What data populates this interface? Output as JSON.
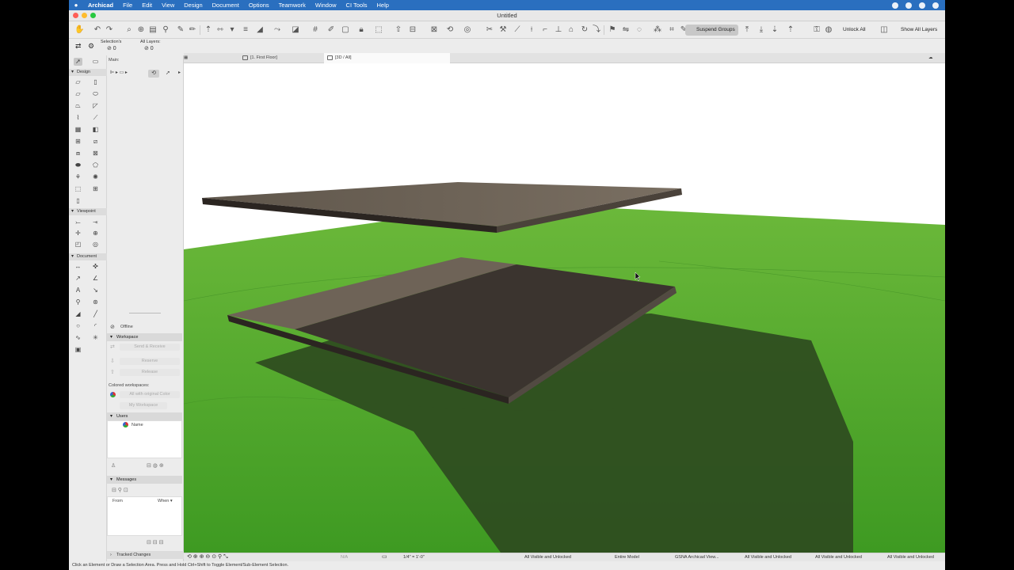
{
  "menubar": {
    "app": "Archicad",
    "items": [
      "File",
      "Edit",
      "View",
      "Design",
      "Document",
      "Options",
      "Teamwork",
      "Window",
      "CI Tools",
      "Help"
    ]
  },
  "window": {
    "title": "Untitled"
  },
  "toolbar": {
    "suspend_groups": "Suspend Groups",
    "unlock_all": "Unlock All",
    "show_all_layers": "Show All Layers"
  },
  "infobox": {
    "selections": "Selection's",
    "all_layers": "All Layers:",
    "main": "Main:"
  },
  "tabs": [
    {
      "label": "[1. First Floor]"
    },
    {
      "label": "[3D / All]"
    }
  ],
  "toolbox": {
    "sections": [
      "Design",
      "Viewpoint",
      "Document"
    ]
  },
  "teamwork": {
    "status": "Offline",
    "workspace_header": "Workspace",
    "send_receive": "Send & Receive",
    "reserve": "Reserve",
    "release": "Release",
    "colored_workspaces": "Colored workspaces:",
    "color_option": "All with original Color",
    "my_workspace": "My Workspace",
    "users_header": "Users",
    "name_col": "Name",
    "messages_header": "Messages",
    "from_col": "From",
    "when_col": "When",
    "tracked_changes": "Tracked Changes"
  },
  "statusbar": {
    "na": "N/A",
    "scale": "1/4\"   =   1'-0\"",
    "layer_combo": "All Visible and Unlocked",
    "model": "Entire Model",
    "view": "GSNA Archicad View...",
    "layer2": "All Visible and Unlocked",
    "layer3": "All Visible and Unlocked",
    "layer4": "All Visible and Unlocked",
    "layer5": "All Visible and Unlocked"
  },
  "hint": "Click an Element or Draw a Selection Area. Press and Hold Ctrl+Shift to Toggle Element/Sub-Element Selection.",
  "colors": {
    "menubar": "#2a6fbf",
    "grass": "#4f9f2c",
    "slab_light": "#6e6357",
    "slab_dark": "#3b342f"
  }
}
